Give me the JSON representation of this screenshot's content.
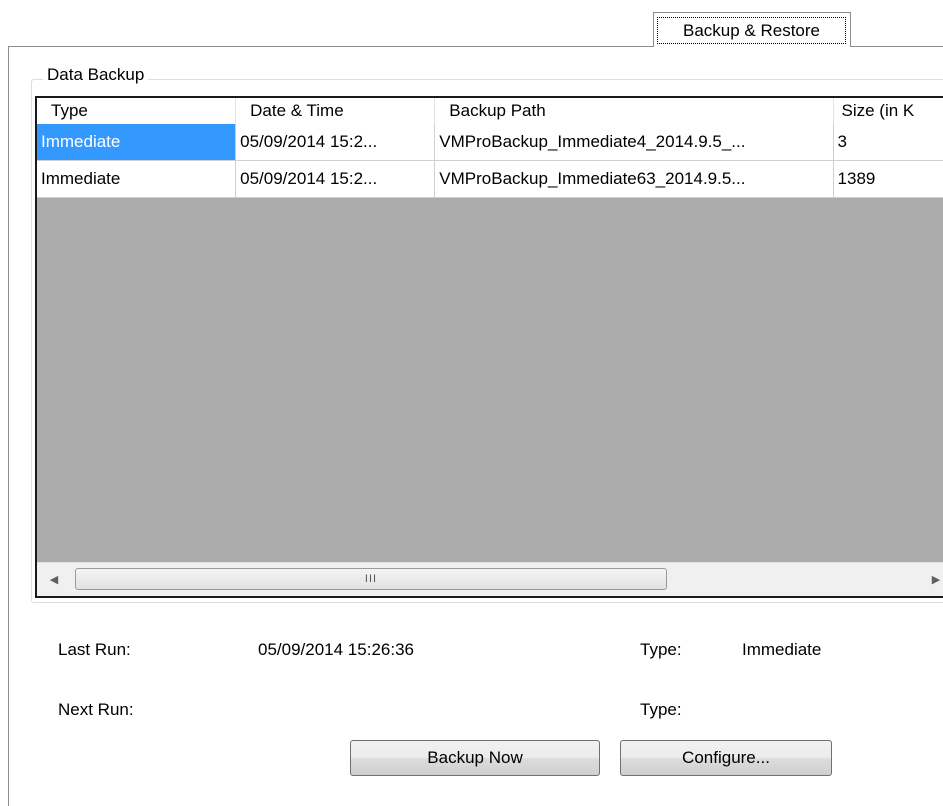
{
  "tab": {
    "label": "Backup & Restore"
  },
  "group": {
    "title": "Data Backup"
  },
  "table": {
    "columns": [
      "Type",
      "Date & Time",
      "Backup Path",
      "Size (in K"
    ],
    "rows": [
      [
        "Immediate",
        "05/09/2014 15:2...",
        "VMProBackup_Immediate4_2014.9.5_...",
        "3"
      ],
      [
        "Immediate",
        "05/09/2014 15:2...",
        "VMProBackup_Immediate63_2014.9.5...",
        "1389"
      ]
    ],
    "selected_row": 0,
    "scrollbar_grip": "III"
  },
  "info": {
    "last_run_label": "Last Run:",
    "last_run_value": "05/09/2014 15:26:36",
    "last_type_label": "Type:",
    "last_type_value": "Immediate",
    "next_run_label": "Next Run:",
    "next_run_value": "",
    "next_type_label": "Type:",
    "next_type_value": ""
  },
  "buttons": {
    "backup_now": "Backup Now",
    "configure": "Configure..."
  },
  "colors": {
    "selection": "#3399ff",
    "list_empty_area": "#ababab"
  }
}
